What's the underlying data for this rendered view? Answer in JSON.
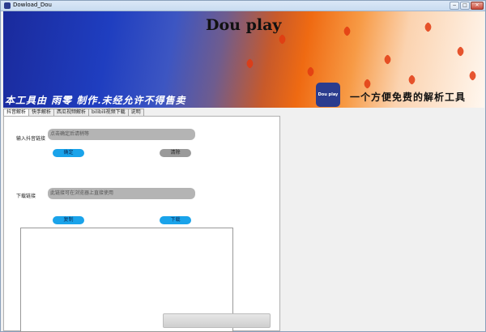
{
  "window": {
    "title": "Dowload_Dou",
    "minimize": "−",
    "maximize": "□",
    "close": "✕"
  },
  "banner": {
    "title": "Dou play",
    "left_slogan": "本工具由 雨零 制作.未经允许不得售卖",
    "logo_text": "Dou play",
    "right_slogan": "一个方便免费的解析工具"
  },
  "tabs": [
    "抖音解析",
    "快手解析",
    "西瓜视频解析",
    "bilibili视频下载",
    "说明"
  ],
  "form": {
    "input_label": "输入抖音链接",
    "input_placeholder": "点击确定后请稍等",
    "confirm_button": "确定",
    "clear_button": "清除",
    "download_label": "下载链接",
    "download_placeholder": "此链接可在浏览器上直接使用",
    "copy_button": "复制",
    "download_button": "下载"
  },
  "colors": {
    "accent": "#1aa3ea",
    "logo": "#2b3c8e",
    "field": "#b4b4b4"
  }
}
